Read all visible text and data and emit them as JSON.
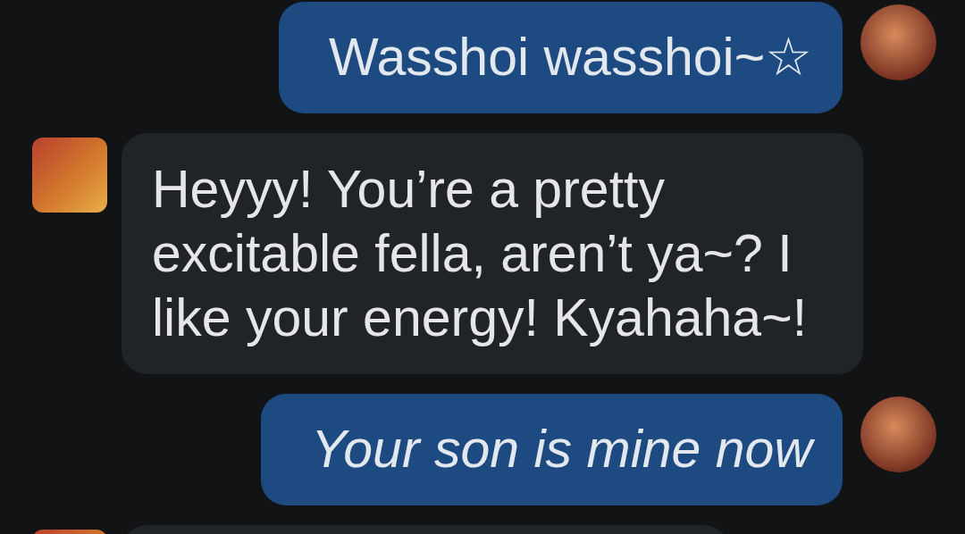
{
  "messages": [
    {
      "kind": "sent",
      "text": "Wasshoi wasshoi~☆",
      "italic": false
    },
    {
      "kind": "received",
      "text": "Heyyy! You’re a pretty excitable fella, aren’t ya~? I like your energy! Kyahaha~!",
      "italic": false
    },
    {
      "kind": "sent",
      "text": "Your son is mine now",
      "italic": true
    },
    {
      "kind": "received"
    }
  ]
}
